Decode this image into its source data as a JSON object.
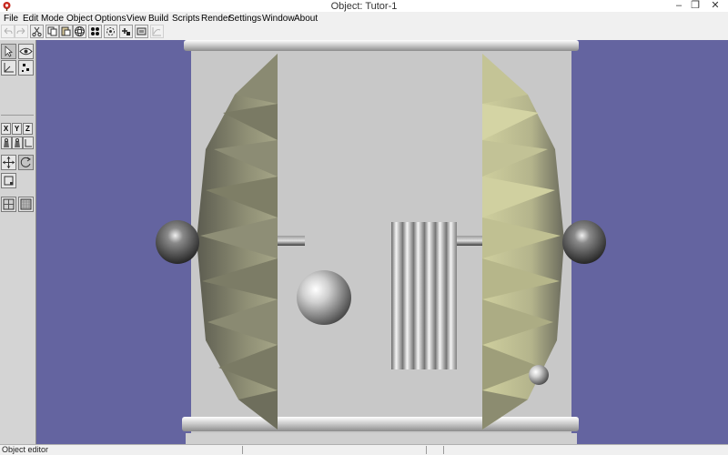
{
  "window": {
    "title": "Object: Tutor-1"
  },
  "menu": {
    "items": [
      "File",
      "Edit",
      "Mode",
      "Object",
      "Options",
      "View",
      "Build",
      "Scripts",
      "Render",
      "Settings",
      "Window",
      "About"
    ]
  },
  "toolbar": {
    "buttons": [
      "undo-icon",
      "redo-icon",
      "cut-icon",
      "copy-icon",
      "paste-icon",
      "sphere-icon",
      "grid-points-icon",
      "rotate-icon",
      "snap-icon",
      "render-icon",
      "graph-icon"
    ]
  },
  "tool_panel": {
    "axis_labels": [
      "X",
      "Y",
      "Z"
    ]
  },
  "statusbar": {
    "text": "Object editor"
  },
  "colors": {
    "viewport_background": "#6464a0",
    "object_panel": "#c8c8c8",
    "dome": "#a0a078"
  }
}
